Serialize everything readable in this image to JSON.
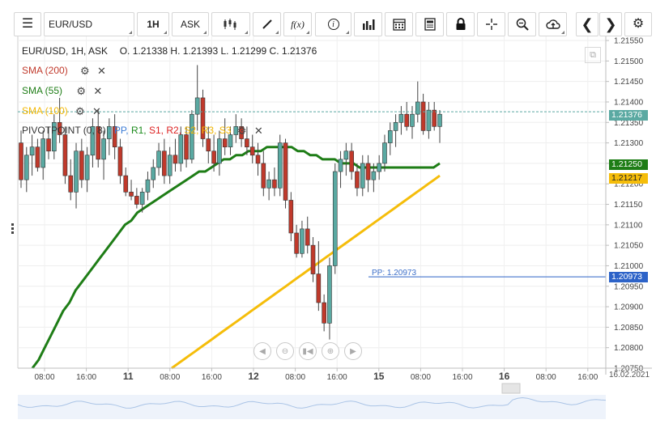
{
  "toolbar": {
    "symbol": "EUR/USD",
    "timeframe": "1H",
    "price_type": "ASK",
    "icons": [
      "menu-icon",
      "candles-icon",
      "draw-icon",
      "fx-icon",
      "info-icon",
      "bars-icon",
      "calendar-icon",
      "notes-icon",
      "lock-icon",
      "crosshair-icon",
      "zoom-icon",
      "cloud-icon",
      "prev-icon",
      "next-icon",
      "settings-icon"
    ],
    "fx_label": "f(x)"
  },
  "header": {
    "instrument": "EUR/USD, 1H, ASK",
    "ohlc": "O. 1.21338 H. 1.21393 L. 1.21299 C. 1.21376"
  },
  "indicators": [
    {
      "label": "SMA (200)",
      "color": "#c0392b"
    },
    {
      "label": "SMA (55)",
      "color": "#1e7d16"
    },
    {
      "label": "SMA (100)",
      "color": "#f2b705"
    }
  ],
  "pivot": {
    "label": "PIVOTPOINT (0, 8)",
    "items": [
      {
        "text": ": PP,",
        "color": "#3a7bd5"
      },
      {
        "text": "R1,",
        "color": "#1a8a1a"
      },
      {
        "text": "S1,",
        "color": "#d22"
      },
      {
        "text": "R2,",
        "color": "#d22"
      },
      {
        "text": "S2,",
        "color": "#f2b705"
      },
      {
        "text": "R3,",
        "color": "#f2b705"
      },
      {
        "text": "S3",
        "color": "#f2b705"
      }
    ]
  },
  "price_tags": {
    "last": "1.21376",
    "sma55": "1.21250",
    "sma100": "1.21217",
    "pp": "1.20973"
  },
  "pp_line_label": "PP: 1.20973",
  "x_axis_end_date": "16.02.2021",
  "nav_icons": [
    "scroll-left-icon",
    "zoom-out-icon",
    "reset-icon",
    "zoom-in-icon",
    "scroll-right-icon"
  ],
  "chart_data": {
    "type": "candlestick",
    "symbol": "EUR/USD",
    "y_ticks": [
      "1.20750",
      "1.20800",
      "1.20850",
      "1.20900",
      "1.20950",
      "1.21000",
      "1.21050",
      "1.21100",
      "1.21150",
      "1.21200",
      "1.21250",
      "1.21300",
      "1.21350",
      "1.21400",
      "1.21450",
      "1.21500",
      "1.21550"
    ],
    "ylim": [
      1.2075,
      1.2156
    ],
    "x_ticks": [
      {
        "label": "08:00",
        "bold": false
      },
      {
        "label": "16:00",
        "bold": false
      },
      {
        "label": "11",
        "bold": true
      },
      {
        "label": "08:00",
        "bold": false
      },
      {
        "label": "16:00",
        "bold": false
      },
      {
        "label": "12",
        "bold": true
      },
      {
        "label": "08:00",
        "bold": false
      },
      {
        "label": "16:00",
        "bold": false
      },
      {
        "label": "15",
        "bold": true
      },
      {
        "label": "08:00",
        "bold": false
      },
      {
        "label": "16:00",
        "bold": false
      },
      {
        "label": "16",
        "bold": true
      },
      {
        "label": "08:00",
        "bold": false
      },
      {
        "label": "16:00",
        "bold": false
      }
    ],
    "candles": [
      [
        1.213,
        1.2133,
        1.2119,
        1.2121
      ],
      [
        1.2121,
        1.2129,
        1.2118,
        1.2127
      ],
      [
        1.2127,
        1.2132,
        1.2122,
        1.2129
      ],
      [
        1.2129,
        1.2131,
        1.2123,
        1.2124
      ],
      [
        1.2124,
        1.2133,
        1.2121,
        1.2131
      ],
      [
        1.2131,
        1.2134,
        1.2126,
        1.2128
      ],
      [
        1.2128,
        1.2137,
        1.2126,
        1.2135
      ],
      [
        1.2135,
        1.2141,
        1.213,
        1.2132
      ],
      [
        1.2132,
        1.2134,
        1.212,
        1.2122
      ],
      [
        1.2122,
        1.2126,
        1.2116,
        1.2118
      ],
      [
        1.2118,
        1.213,
        1.2114,
        1.2128
      ],
      [
        1.2128,
        1.2131,
        1.2119,
        1.2121
      ],
      [
        1.2121,
        1.2129,
        1.2118,
        1.2127
      ],
      [
        1.2127,
        1.2136,
        1.2124,
        1.2134
      ],
      [
        1.2134,
        1.2138,
        1.2124,
        1.2126
      ],
      [
        1.2126,
        1.2133,
        1.2121,
        1.2131
      ],
      [
        1.2131,
        1.2136,
        1.2127,
        1.2134
      ],
      [
        1.2134,
        1.2137,
        1.2126,
        1.2129
      ],
      [
        1.2129,
        1.2131,
        1.212,
        1.2122
      ],
      [
        1.2122,
        1.2124,
        1.2117,
        1.2118
      ],
      [
        1.2118,
        1.2121,
        1.2116,
        1.2117
      ],
      [
        1.2117,
        1.2119,
        1.2114,
        1.2115
      ],
      [
        1.2115,
        1.2119,
        1.2113,
        1.2118
      ],
      [
        1.2118,
        1.2123,
        1.2116,
        1.2121
      ],
      [
        1.2121,
        1.2126,
        1.2119,
        1.2124
      ],
      [
        1.2124,
        1.213,
        1.2122,
        1.2128
      ],
      [
        1.2128,
        1.2131,
        1.212,
        1.2122
      ],
      [
        1.2122,
        1.2129,
        1.212,
        1.2127
      ],
      [
        1.2127,
        1.2131,
        1.2123,
        1.2125
      ],
      [
        1.2125,
        1.2134,
        1.2123,
        1.2132
      ],
      [
        1.2132,
        1.2134,
        1.2124,
        1.2126
      ],
      [
        1.2126,
        1.2138,
        1.2125,
        1.2137
      ],
      [
        1.2137,
        1.2149,
        1.2133,
        1.2141
      ],
      [
        1.2141,
        1.2143,
        1.2129,
        1.2131
      ],
      [
        1.2131,
        1.2134,
        1.2125,
        1.2128
      ],
      [
        1.2128,
        1.2132,
        1.2123,
        1.2125
      ],
      [
        1.2125,
        1.2133,
        1.2122,
        1.2131
      ],
      [
        1.2131,
        1.2136,
        1.2127,
        1.2129
      ],
      [
        1.2129,
        1.2134,
        1.2127,
        1.2132
      ],
      [
        1.2132,
        1.2137,
        1.213,
        1.2134
      ],
      [
        1.2134,
        1.2136,
        1.2129,
        1.2131
      ],
      [
        1.2131,
        1.2134,
        1.2127,
        1.2129
      ],
      [
        1.2129,
        1.2132,
        1.2125,
        1.2127
      ],
      [
        1.2127,
        1.213,
        1.2122,
        1.2125
      ],
      [
        1.2125,
        1.2128,
        1.2117,
        1.2119
      ],
      [
        1.2119,
        1.2123,
        1.2116,
        1.2121
      ],
      [
        1.2121,
        1.2124,
        1.2117,
        1.2119
      ],
      [
        1.2119,
        1.2132,
        1.2117,
        1.213
      ],
      [
        1.213,
        1.2131,
        1.2114,
        1.2116
      ],
      [
        1.2116,
        1.2118,
        1.2106,
        1.2108
      ],
      [
        1.2108,
        1.211,
        1.2102,
        1.2103
      ],
      [
        1.2103,
        1.2111,
        1.2102,
        1.2109
      ],
      [
        1.2109,
        1.2112,
        1.2103,
        1.2105
      ],
      [
        1.2105,
        1.2107,
        1.2096,
        1.2098
      ],
      [
        1.2098,
        1.2106,
        1.2089,
        1.2091
      ],
      [
        1.2091,
        1.2093,
        1.2084,
        1.2086
      ],
      [
        1.2086,
        1.2102,
        1.2082,
        1.21
      ],
      [
        1.21,
        1.2125,
        1.2098,
        1.2123
      ],
      [
        1.2123,
        1.2128,
        1.2119,
        1.2126
      ],
      [
        1.2126,
        1.213,
        1.2122,
        1.2128
      ],
      [
        1.2128,
        1.213,
        1.2121,
        1.2123
      ],
      [
        1.2123,
        1.2125,
        1.2117,
        1.2119
      ],
      [
        1.2119,
        1.2127,
        1.2117,
        1.2125
      ],
      [
        1.2125,
        1.2127,
        1.2118,
        1.2121
      ],
      [
        1.2121,
        1.2125,
        1.2118,
        1.2123
      ],
      [
        1.2123,
        1.2127,
        1.2121,
        1.2125
      ],
      [
        1.2125,
        1.2132,
        1.2123,
        1.213
      ],
      [
        1.213,
        1.2135,
        1.2127,
        1.2133
      ],
      [
        1.2133,
        1.2137,
        1.2129,
        1.2135
      ],
      [
        1.2135,
        1.2139,
        1.2132,
        1.2137
      ],
      [
        1.2137,
        1.214,
        1.2133,
        1.2134
      ],
      [
        1.2134,
        1.2139,
        1.2131,
        1.2137
      ],
      [
        1.2137,
        1.2145,
        1.2135,
        1.214
      ],
      [
        1.214,
        1.2142,
        1.2132,
        1.2133
      ],
      [
        1.2133,
        1.214,
        1.2131,
        1.2138
      ],
      [
        1.2138,
        1.214,
        1.2133,
        1.2134
      ],
      [
        1.2134,
        1.2138,
        1.213,
        1.2137
      ]
    ],
    "sma55": [
      1.2075,
      1.2077,
      1.208,
      1.2083,
      1.2086,
      1.2089,
      1.2091,
      1.2094,
      1.2096,
      1.2098,
      1.21,
      1.2102,
      1.2104,
      1.2106,
      1.2108,
      1.211,
      1.2111,
      1.2113,
      1.2114,
      1.2115,
      1.2116,
      1.2117,
      1.2118,
      1.2119,
      1.212,
      1.2121,
      1.2122,
      1.2123,
      1.2123,
      1.2124,
      1.2125,
      1.2126,
      1.2126,
      1.2127,
      1.2127,
      1.2128,
      1.2128,
      1.2128,
      1.2129,
      1.2129,
      1.2129,
      1.2129,
      1.2129,
      1.2128,
      1.2128,
      1.2127,
      1.2127,
      1.2126,
      1.2126,
      1.2126,
      1.2125,
      1.2125,
      1.2125,
      1.2124,
      1.2124,
      1.2124,
      1.2124,
      1.2124,
      1.2124,
      1.2124,
      1.2124,
      1.2124,
      1.2124,
      1.2124,
      1.2124,
      1.2124,
      1.2125
    ],
    "sma100": [
      1.2075,
      1.2076,
      1.2077,
      1.2078,
      1.2079,
      1.208,
      1.2081,
      1.2082,
      1.2083,
      1.2084,
      1.2085,
      1.2086,
      1.2087,
      1.2088,
      1.2089,
      1.209,
      1.2091,
      1.2092,
      1.2093,
      1.2094,
      1.2095,
      1.2096,
      1.2097,
      1.2098,
      1.2099,
      1.21,
      1.2101,
      1.2102,
      1.2103,
      1.2104,
      1.2105,
      1.2106,
      1.2107,
      1.2108,
      1.2109,
      1.211,
      1.2111,
      1.2112,
      1.2113,
      1.2114,
      1.2115,
      1.2116,
      1.2117,
      1.2118,
      1.2119,
      1.212,
      1.2121,
      1.2122
    ],
    "pivot_pp": 1.20973,
    "last_price": 1.21376
  }
}
